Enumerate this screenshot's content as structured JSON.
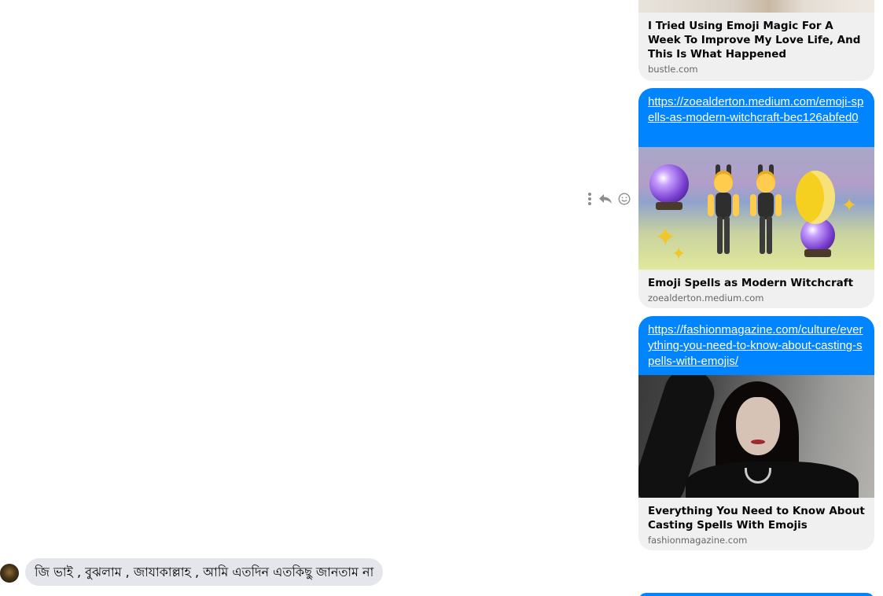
{
  "messages": {
    "link_card_1": {
      "title": "I Tried Using Emoji Magic For A Week To Improve My Love Life, And This Is What Happened",
      "domain": "bustle.com"
    },
    "link_card_2": {
      "url": "https://zoealderton.medium.com/emoji-spells-as-modern-witchcraft-bec126abfed0",
      "title": "Emoji Spells as Modern Witchcraft",
      "domain": "zoealderton.medium.com",
      "preview_image": "emoji crystal balls, bunny dancers, moon and sparkles"
    },
    "link_card_3": {
      "url": "https://fashionmagazine.com/culture/everything-you-need-to-know-about-casting-spells-with-emojis/",
      "title": "Everything You Need to Know About Casting Spells With Emojis",
      "domain": "fashionmagazine.com",
      "preview_image": "woman in black dress raising arm"
    },
    "incoming_text": "জি ভাই , বুঝলাম , জাযাকাল্লাহ , আমি এতদিন এতকিছু জানতাম না"
  },
  "hover_actions": {
    "icons": [
      "more-icon",
      "reply-icon",
      "react-icon"
    ]
  },
  "colors": {
    "outgoing_bubble": "#0084ff",
    "incoming_bubble": "#e4e6eb",
    "card_background": "#f0f0f0",
    "secondary_text": "#65676b"
  }
}
